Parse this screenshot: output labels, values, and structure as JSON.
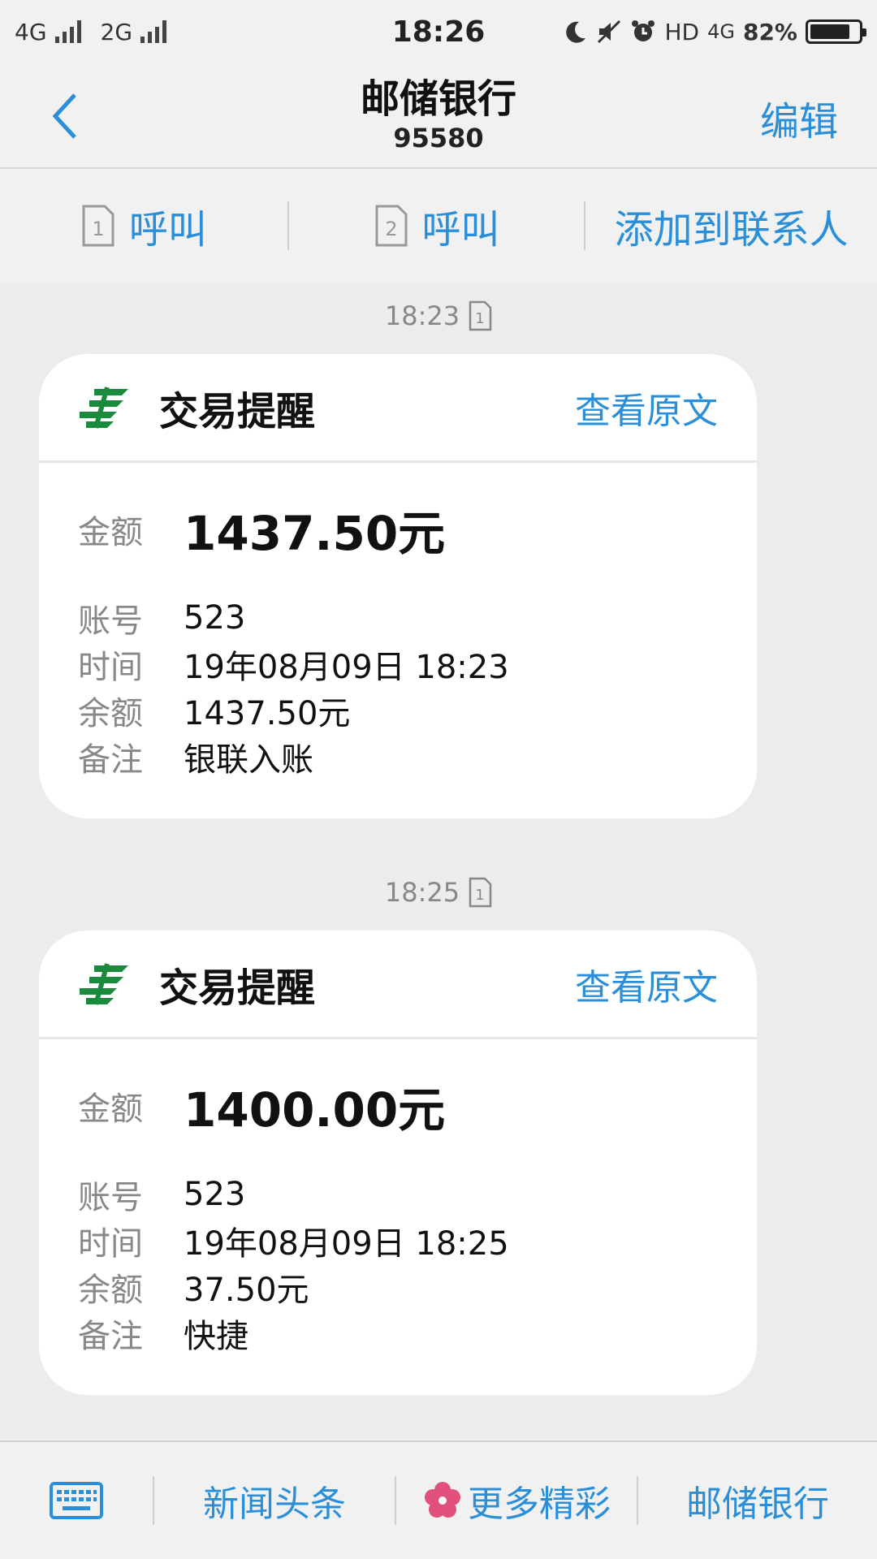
{
  "status": {
    "network1": "4G",
    "network2": "2G",
    "time": "18:26",
    "hd": "HD",
    "net4g": "4G",
    "battery": "82%",
    "battery_level": 0.82
  },
  "header": {
    "title": "邮储银行",
    "number": "95580",
    "edit_label": "编辑"
  },
  "call_bar": {
    "call1_sim": "1",
    "call1_label": "呼叫",
    "call2_sim": "2",
    "call2_label": "呼叫",
    "add_contact_label": "添加到联系人"
  },
  "messages": [
    {
      "time": "18:23",
      "sim": "1",
      "title": "交易提醒",
      "view_label": "查看原文",
      "amount_label": "金额",
      "amount": "1437.50元",
      "rows": [
        {
          "label": "账号",
          "value": "523"
        },
        {
          "label": "时间",
          "value": "19年08月09日 18:23"
        },
        {
          "label": "余额",
          "value": "1437.50元"
        },
        {
          "label": "备注",
          "value": "银联入账"
        }
      ]
    },
    {
      "time": "18:25",
      "sim": "1",
      "title": "交易提醒",
      "view_label": "查看原文",
      "amount_label": "金额",
      "amount": "1400.00元",
      "rows": [
        {
          "label": "账号",
          "value": "523"
        },
        {
          "label": "时间",
          "value": "19年08月09日 18:25"
        },
        {
          "label": "余额",
          "value": "37.50元"
        },
        {
          "label": "备注",
          "value": "快捷"
        }
      ]
    }
  ],
  "bottom_bar": {
    "item1": "新闻头条",
    "item2": "更多精彩",
    "item3": "邮储银行"
  },
  "colors": {
    "accent": "#2a8fd8",
    "logo_green": "#1a8a3c",
    "flower_pink": "#e0507a"
  }
}
